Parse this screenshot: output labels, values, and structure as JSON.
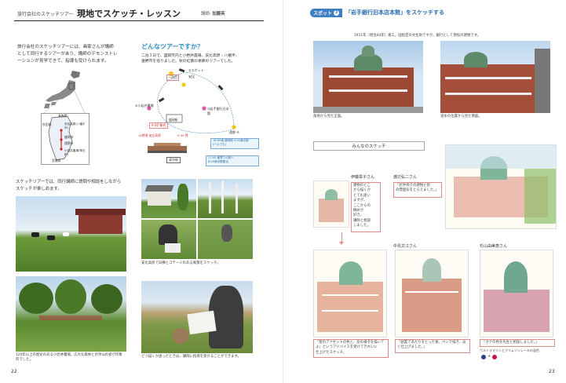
{
  "left": {
    "series": "旅行会社のスケッチツアー",
    "title": "現地でスケッチ・レッスン",
    "byline_label": "講師:",
    "byline_name": "加藤英",
    "intro": [
      "旅行会社のスケッチツアーには、画家さんが講師",
      "として同行するツアーがあり、講師のデモンストレ",
      "ーションが見学できて、指導も受けられます。"
    ],
    "question": "どんなツアーですか？",
    "tour_desc": [
      "二泊３日で、盛岡市内と小岩井農場、安比高原・八幡平、",
      "遠野市を巡りました。秋の紅葉の季節のツアーでした。"
    ],
    "map_labels": [
      "青森県",
      "秋田県",
      "安比高原(八幡平市)",
      "盛岡市",
      "遠野市",
      "小岩井農場(雫石町)",
      "宮城県"
    ],
    "route": {
      "spot2": "②スポット",
      "spot_ahi": "安比",
      "dai1": "一泊目",
      "spot1": "①小岩井農場",
      "spot3": "③岩手銀行日本館",
      "tono": "遠野 ④",
      "morioka": "盛岡駅",
      "time1": "9:00 集合",
      "time2": "14時頃 安比高原",
      "time3": "5:30 帰",
      "tokyo": "東京駅",
      "note1": "16:00頃 盛岡駅 9:00東京駅",
      "note2": "17:00 最寄りの駅へ",
      "note3": "(バスでも)",
      "note4": "8:00東京駅集合"
    },
    "text2": [
      "スケッチツアーでは、同行講師に質問や相談をしながら",
      "スケッチが楽しめます。"
    ],
    "cap_walk": "安比高原で白樺とコテージのある風景をスケッチ。",
    "cap_farm": [
      "120年以上の歴史のある小岩井農場。広大な森林と岩手山の姿が印象",
      "的でした。"
    ],
    "cap_park": "どう描くか迷ったときは、講師に指導を受けることができます。",
    "page": "22"
  },
  "right": {
    "spot_badge": "スポット",
    "spot_num": "3",
    "spot_title": "「岩手銀行旧本店本館」をスケッチする",
    "desc": "1911年（明治44年）竣工。国指定の文化財ですが、銀行として現役の建物です。",
    "cap1": "角地から見た正面。",
    "cap2": "道ゆの位置から見た側面。",
    "section": "みんなのスケッチ",
    "artists": [
      {
        "name": "伊藤栄子さん",
        "comment": [
          "建物のどこ",
          "から描くか",
          "とても迷い",
          "ますが、",
          "ここからの",
          "眺めが",
          "好き。",
          "講師と相談",
          "しました。"
        ]
      },
      {
        "name": "渡辺弘二さん",
        "comment": [
          "「岩手県庁の建物と街",
          "の雰囲気をとらえました。」"
        ]
      },
      {
        "name": "中島文江さん",
        "comment": [
          "「屋のアクセントの色と、窓の様子を描いて",
          "よ」というアドバイスを受けてきれいに",
          "仕上げたスケッチ。"
        ]
      },
      {
        "name": "杉山由美恵さん",
        "comment": [
          "「副業であたりをとった後、ペンで描き、淡",
          "く仕上げました。」"
        ]
      }
    ],
    "last_name": "杉山由美恵さん",
    "last_comment": [
      "「カナの色を先生と相談しました。」",
      "ウルトラマリンとクリムゾンレーキの混色"
    ],
    "page": "23"
  }
}
